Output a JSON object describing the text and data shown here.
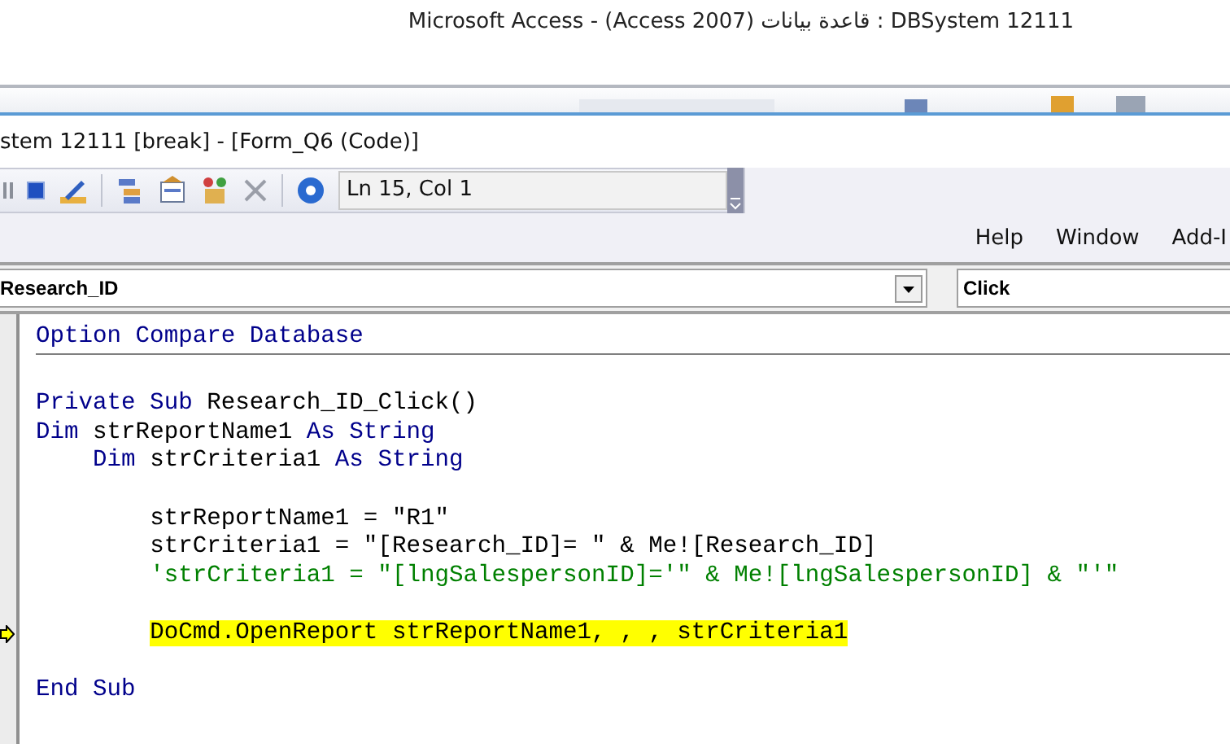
{
  "app_title": "Microsoft Access  -  (Access 2007) قاعدة بيانات : DBSystem 12111",
  "editor": {
    "title": "stem 12111 [break] - [Form_Q6 (Code)]",
    "toolbar": {
      "position": "Ln 15, Col 1"
    },
    "menu": [
      "Help",
      "Window",
      "Add-I"
    ],
    "object_box": {
      "value": "Research_ID"
    },
    "procedure_box": {
      "value": "Click"
    },
    "code_lines": [
      {
        "kind": "code",
        "tokens": [
          {
            "kind": "keyword",
            "text": "Option Compare Database"
          }
        ],
        "highlighted": false,
        "execution_point": false
      },
      {
        "kind": "separator"
      },
      {
        "kind": "blank"
      },
      {
        "kind": "code",
        "tokens": [
          {
            "kind": "keyword",
            "text": "Private Sub"
          },
          {
            "kind": "plain",
            "text": " Research_ID_Click()"
          }
        ],
        "highlighted": false,
        "execution_point": false
      },
      {
        "kind": "code",
        "tokens": [
          {
            "kind": "keyword",
            "text": "Dim"
          },
          {
            "kind": "plain",
            "text": " strReportName1 "
          },
          {
            "kind": "keyword",
            "text": "As String"
          }
        ],
        "highlighted": false,
        "execution_point": false
      },
      {
        "kind": "code",
        "tokens": [
          {
            "kind": "keyword",
            "text": "    Dim"
          },
          {
            "kind": "plain",
            "text": " strCriteria1 "
          },
          {
            "kind": "keyword",
            "text": "As String"
          }
        ],
        "highlighted": false,
        "execution_point": false
      },
      {
        "kind": "blank"
      },
      {
        "kind": "code",
        "tokens": [
          {
            "kind": "plain",
            "text": "        strReportName1 = \"R1\""
          }
        ],
        "highlighted": false,
        "execution_point": false
      },
      {
        "kind": "code",
        "tokens": [
          {
            "kind": "plain",
            "text": "        strCriteria1 = \"[Research_ID]= \" & Me![Research_ID]"
          }
        ],
        "highlighted": false,
        "execution_point": false
      },
      {
        "kind": "code",
        "tokens": [
          {
            "kind": "comment",
            "text": "        'strCriteria1 = \"[lngSalespersonID]='\" & Me![lngSalespersonID] & \"'\""
          }
        ],
        "highlighted": false,
        "execution_point": false
      },
      {
        "kind": "blank"
      },
      {
        "kind": "code",
        "tokens": [
          {
            "kind": "plain",
            "text": "        DoCmd.OpenReport strReportName1, , , strCriteria1"
          }
        ],
        "highlighted": true,
        "execution_point": true
      },
      {
        "kind": "blank"
      },
      {
        "kind": "code",
        "tokens": [
          {
            "kind": "keyword",
            "text": "End Sub"
          }
        ],
        "highlighted": false,
        "execution_point": false
      }
    ]
  }
}
